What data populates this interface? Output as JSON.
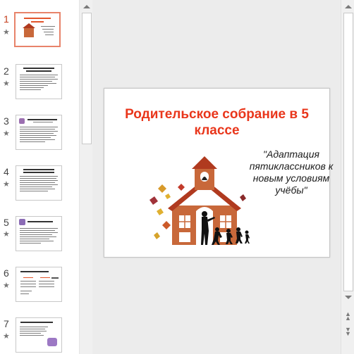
{
  "thumbnails": [
    {
      "number": "1",
      "active": true
    },
    {
      "number": "2",
      "active": false
    },
    {
      "number": "3",
      "active": false
    },
    {
      "number": "4",
      "active": false
    },
    {
      "number": "5",
      "active": false
    },
    {
      "number": "6",
      "active": false
    },
    {
      "number": "7",
      "active": false
    }
  ],
  "slide": {
    "title": "Родительское собрание в 5 классе",
    "subtitle": "\"Адаптация пятиклассников к новым условиям учёбы\""
  },
  "icons": {
    "star": "star-icon",
    "scroll_up": "triangle-up",
    "scroll_down": "triangle-down",
    "prev_slide": "double-chevron-up",
    "next_slide": "double-chevron-down"
  },
  "colors": {
    "accent": "#c43e1c",
    "active_border": "#e8836a",
    "title": "#e9361b",
    "house": "#c8683a",
    "roof": "#b03a1f"
  }
}
